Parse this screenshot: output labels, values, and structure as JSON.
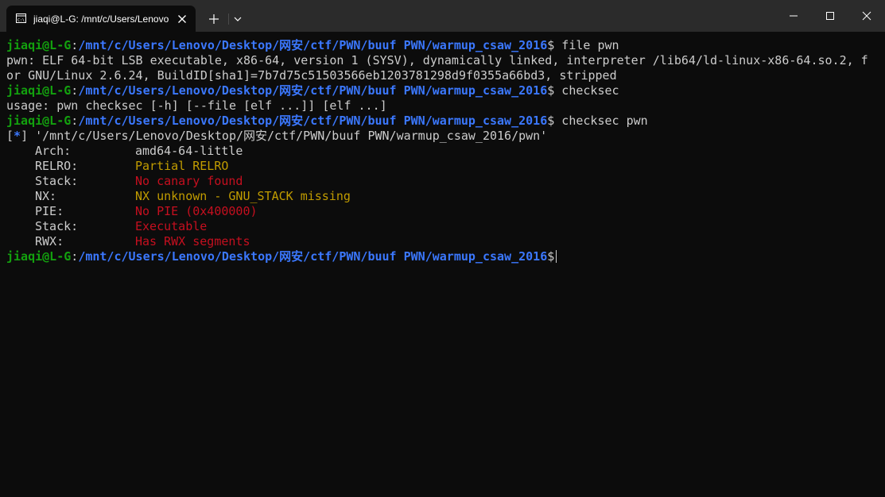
{
  "tab": {
    "title": "jiaqi@L-G: /mnt/c/Users/Lenovo",
    "icon": "terminal-icon"
  },
  "colors": {
    "background": "#0c0c0c",
    "titlebar": "#2b2b2b",
    "prompt_user": "#13a10e",
    "prompt_path": "#3b78ff",
    "text": "#cccccc",
    "red": "#c50f1f",
    "yellow": "#c19c00"
  },
  "prompt": {
    "user": "jiaqi@L-G",
    "colon": ":",
    "path": "/mnt/c/Users/Lenovo/Desktop/网安/ctf/PWN/buuf PWN/warmup_csaw_2016",
    "symbol": "$"
  },
  "commands": {
    "cmd1": " file pwn",
    "cmd2": " checksec",
    "cmd3": " checksec pwn"
  },
  "output": {
    "file_line1": "pwn: ELF 64-bit LSB executable, x86-64, version 1 (SYSV), dynamically linked, interpreter /lib64/ld-linux-x86-64.so.2, f",
    "file_line2": "or GNU/Linux 2.6.24, BuildID[sha1]=7b7d75c51503566eb1203781298d9f0355a66bd3, stripped",
    "usage": "usage: pwn checksec [-h] [--file [elf ...]] [elf ...]",
    "info_open": "[",
    "info_star": "*",
    "info_close": "]",
    "info_path": " '/mnt/c/Users/Lenovo/Desktop/网安/ctf/PWN/buuf PWN/warmup_csaw_2016/pwn'"
  },
  "checksec": [
    {
      "key": "Arch:",
      "value": "amd64-64-little",
      "color": "default"
    },
    {
      "key": "RELRO:",
      "value": "Partial RELRO",
      "color": "yellow"
    },
    {
      "key": "Stack:",
      "value": "No canary found",
      "color": "red"
    },
    {
      "key": "NX:",
      "value": "NX unknown - GNU_STACK missing",
      "color": "yellow"
    },
    {
      "key": "PIE:",
      "value": "No PIE (0x400000)",
      "color": "red"
    },
    {
      "key": "Stack:",
      "value": "Executable",
      "color": "red"
    },
    {
      "key": "RWX:",
      "value": "Has RWX segments",
      "color": "red"
    }
  ]
}
